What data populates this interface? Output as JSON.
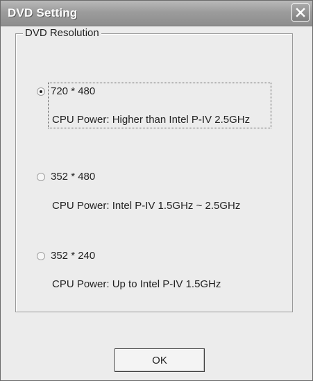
{
  "window": {
    "title": "DVD Setting"
  },
  "group": {
    "label": "DVD Resolution"
  },
  "options": [
    {
      "label": "720 * 480",
      "description": "CPU Power: Higher than Intel P-IV 2.5GHz",
      "selected": true
    },
    {
      "label": "352 * 480",
      "description": "CPU Power: Intel P-IV 1.5GHz ~ 2.5GHz",
      "selected": false
    },
    {
      "label": "352 * 240",
      "description": "CPU Power: Up to Intel P-IV 1.5GHz",
      "selected": false
    }
  ],
  "buttons": {
    "ok_label": "OK"
  },
  "icons": {
    "close": "close-icon"
  }
}
